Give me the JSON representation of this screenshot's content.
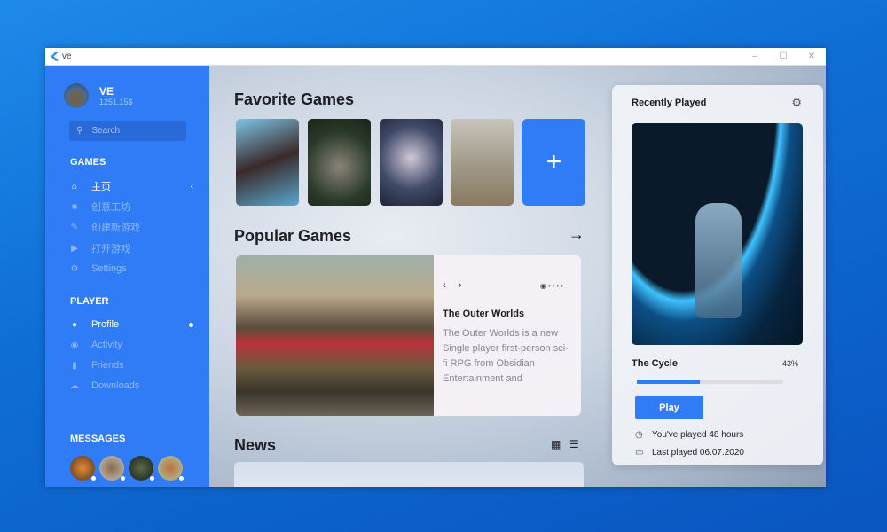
{
  "window": {
    "title": "ve",
    "minimize": "–",
    "maximize": "☐",
    "close": "✕"
  },
  "user": {
    "name": "VE",
    "balance": "1251.15$"
  },
  "search": {
    "placeholder": "Search"
  },
  "sidebar": {
    "games_title": "GAMES",
    "games": [
      {
        "label": "主页",
        "icon": "home-icon",
        "active": true
      },
      {
        "label": "创意工坊",
        "icon": "briefcase-icon"
      },
      {
        "label": "创建新游戏",
        "icon": "pencil-icon"
      },
      {
        "label": "打开游戏",
        "icon": "play-icon"
      },
      {
        "label": "Settings",
        "icon": "gear-icon"
      }
    ],
    "player_title": "PLAYER",
    "player": [
      {
        "label": "Profile",
        "icon": "person-icon",
        "active": true
      },
      {
        "label": "Activity",
        "icon": "target-icon"
      },
      {
        "label": "Friends",
        "icon": "chat-icon"
      },
      {
        "label": "Downloads",
        "icon": "cloud-download-icon"
      }
    ],
    "messages_title": "MESSAGES"
  },
  "main": {
    "favorite_title": "Favorite Games",
    "popular_title": "Popular Games",
    "news_title": "News",
    "popular": {
      "title": "The Outer Worlds",
      "description": "The Outer Worlds is a new Single player first-person sci-fi RPG from Obsidian Entertainment and"
    }
  },
  "recent": {
    "title": "Recently Played",
    "game": "The Cycle",
    "progress": 43,
    "progress_label": "43%",
    "play": "Play",
    "played": "You've played 48 hours",
    "last_played": "Last played 06.07.2020"
  },
  "colors": {
    "accent": "#2f7cf6"
  }
}
